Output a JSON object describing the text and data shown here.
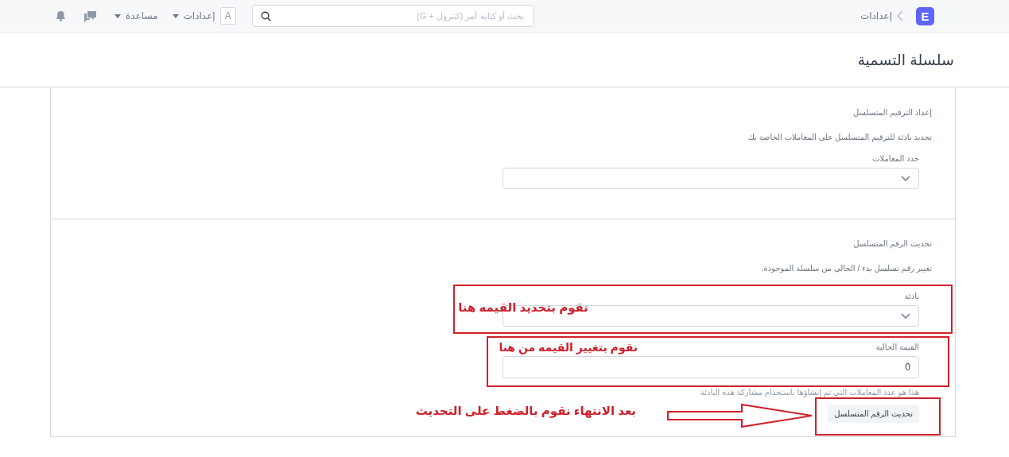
{
  "topbar": {
    "logo": "E",
    "breadcrumb": "إعدادات",
    "search": {
      "placeholder": "بحث أو كتابة أمر (كنترول + G)"
    },
    "avatar": "A",
    "menus": [
      {
        "label": "إعدادات"
      },
      {
        "label": "مساعدة"
      }
    ]
  },
  "page_title": "سلسلة التسمية",
  "sections": [
    {
      "title": "إعداد الترقيم المتسلسل",
      "description": "تحديد بادئة للترقيم المتسلسل على المعاملات الخاصة بك",
      "fields": [
        {
          "kind": "select",
          "label": "حدد المعاملات"
        }
      ]
    },
    {
      "title": "تحديث الرقم المتسلسل",
      "description": "تغيير رقم تسلسل بدء / الحالي من سلسلة الموجودة.",
      "fields": [
        {
          "kind": "select",
          "label": "بادئة"
        },
        {
          "kind": "input",
          "label": "القيمة الحالية",
          "value": "0",
          "help": "هذا هو عدد المعاملات التي تم إنشاؤها باستخدام مشاركة هذه البادئة"
        }
      ],
      "button": "تحديث الرقم المتسلسل"
    }
  ],
  "annotations": [
    {
      "text": "نقوم بتحديد القيمه هنا"
    },
    {
      "text": "نقوم بتغيير القيمه من هنا"
    },
    {
      "text": "بعد الانتهاء نقوم بالضغط على التحديث"
    }
  ]
}
